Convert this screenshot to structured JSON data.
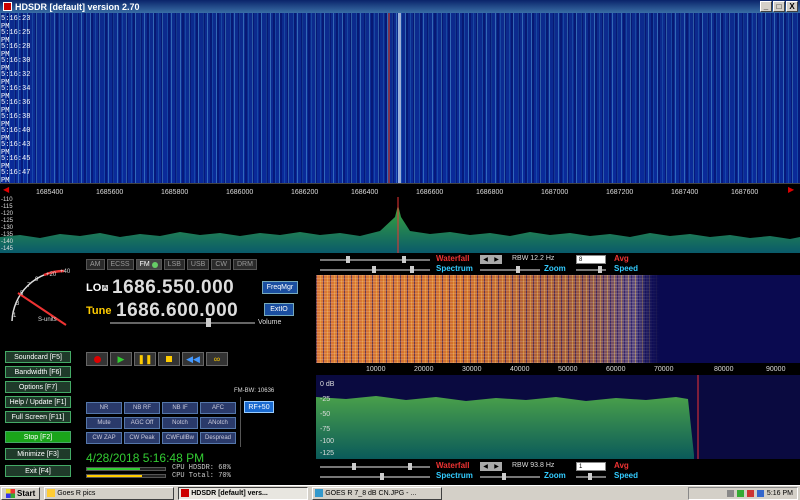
{
  "window": {
    "title": "HDSDR [default]  version 2.70",
    "buttons": [
      "_",
      "□",
      "X"
    ]
  },
  "waterfall_top": {
    "times": [
      "5:16:23 PM",
      "5:16:25 PM",
      "5:16:28 PM",
      "5:16:30 PM",
      "5:16:32 PM",
      "5:16:34 PM",
      "5:16:36 PM",
      "5:16:38 PM",
      "5:16:40 PM",
      "5:16:43 PM",
      "5:16:45 PM",
      "5:16:47 PM"
    ]
  },
  "freq_axis": [
    "1685400",
    "1685600",
    "1685800",
    "1686000",
    "1686200",
    "1686400",
    "1686600",
    "1686800",
    "1687000",
    "1687200",
    "1687400",
    "1687600"
  ],
  "spectrum_db": [
    "-110",
    "-115",
    "-120",
    "-125",
    "-130",
    "-135",
    "-140",
    "-145"
  ],
  "smeter": {
    "unit_label": "S-units",
    "scale": [
      "1",
      "3",
      "5",
      "7",
      "9",
      "+20",
      "+40"
    ]
  },
  "modes": [
    {
      "label": "AM",
      "active": false
    },
    {
      "label": "ECSS",
      "active": false
    },
    {
      "label": "FM",
      "active": true
    },
    {
      "label": "LSB",
      "active": false
    },
    {
      "label": "USB",
      "active": false
    },
    {
      "label": "CW",
      "active": false
    },
    {
      "label": "DRM",
      "active": false
    }
  ],
  "lo": {
    "label": "LO",
    "badge": "A",
    "value": "1686.550.000"
  },
  "tune": {
    "label": "Tune",
    "value": "1686.600.000"
  },
  "freq_mgr": "FreqMgr",
  "ext_io": "ExtIO",
  "volume_label": "Volume",
  "side_buttons": [
    "Soundcard [F5]",
    "Bandwidth [F6]",
    "Options [F7]",
    "Help / Update [F1]",
    "Full Screen [F11]",
    "Stop [F2]",
    "Minimize [F3]",
    "Exit [F4]"
  ],
  "fm_bw": "FM-BW: 10636",
  "rf_plus": "RF+50",
  "dsp_buttons": [
    "NR",
    "NB RF",
    "NB IF",
    "AFC",
    "Mute",
    "AGC Off",
    "Notch",
    "ANotch",
    "CW ZAP",
    "CW Peak",
    "CWFullBw",
    "Despread"
  ],
  "clock": "4/28/2018 5:16:48 PM",
  "cpu": {
    "hdsdr": "CPU HDSDR: 68%",
    "total": "CPU Total: 70%",
    "hdsdr_pct": 68,
    "total_pct": 70
  },
  "rf_toolbar": {
    "waterfall": "Waterfall",
    "spectrum": "Spectrum",
    "rbw": "RBW 12.2 Hz",
    "rbw_sel": "8",
    "avg": "Avg",
    "zoom": "Zoom",
    "speed": "Speed"
  },
  "audio_axis": [
    "10000",
    "20000",
    "30000",
    "40000",
    "50000",
    "60000",
    "70000",
    "80000",
    "90000"
  ],
  "audio_db": [
    "0 dB",
    "-25",
    "-50",
    "-75",
    "-100",
    "-125"
  ],
  "af_toolbar": {
    "waterfall": "Waterfall",
    "spectrum": "Spectrum",
    "rbw": "RBW 93.8 Hz",
    "rbw_sel": "1",
    "avg": "Avg",
    "zoom": "Zoom",
    "speed": "Speed"
  },
  "taskbar": {
    "start": "Start",
    "items": [
      {
        "label": "Goes R pics",
        "active": false
      },
      {
        "label": "HDSDR [default] vers...",
        "active": true
      },
      {
        "label": "GOES R 7_8 dB CN.JPG - ...",
        "active": false
      }
    ],
    "time": "5:16 PM"
  }
}
